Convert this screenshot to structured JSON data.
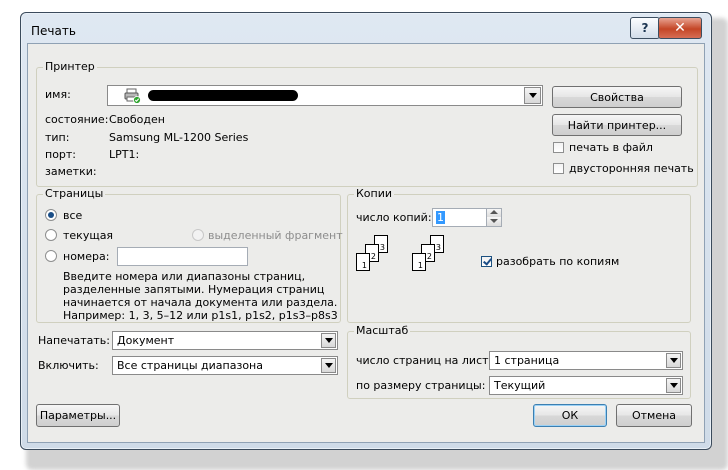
{
  "window": {
    "title": "Печать",
    "help_label": "?",
    "close_label": "✕"
  },
  "printer": {
    "group_label": "Принтер",
    "name_label": "имя:",
    "name_value": "",
    "status_label": "состояние:",
    "status_value": "Свободен",
    "type_label": "тип:",
    "type_value": "Samsung ML-1200 Series",
    "port_label": "порт:",
    "port_value": "LPT1:",
    "notes_label": "заметки:",
    "properties_button": "Свойства",
    "find_button": "Найти принтер...",
    "print_to_file_label": "печать в файл",
    "duplex_label": "двусторонняя печать"
  },
  "pages": {
    "group_label": "Страницы",
    "all_label": "все",
    "current_label": "текущая",
    "selection_label": "выделенный фрагмент",
    "numbers_label": "номера:",
    "numbers_value": "",
    "help_line1": "Введите номера или диапазоны страниц,",
    "help_line2": "разделенные запятыми. Нумерация страниц",
    "help_line3": "начинается от начала документа или раздела.",
    "help_line4": "Например: 1, 3, 5–12 или p1s1, p1s2, p1s3–p8s3"
  },
  "copies": {
    "group_label": "Копии",
    "count_label": "число копий:",
    "count_value": "1",
    "collate_label": "разобрать по копиям",
    "stack_pages": [
      "1",
      "2",
      "3"
    ]
  },
  "print_what": {
    "label": "Напечатать:",
    "value": "Документ"
  },
  "include": {
    "label": "Включить:",
    "value": "Все страницы диапазона"
  },
  "zoom": {
    "group_label": "Масштаб",
    "pages_per_sheet_label": "число страниц на листе:",
    "pages_per_sheet_value": "1 страница",
    "scale_label": "по размеру страницы:",
    "scale_value": "Текущий"
  },
  "footer": {
    "options_button": "Параметры...",
    "ok_button": "ОК",
    "cancel_button": "Отмена"
  }
}
